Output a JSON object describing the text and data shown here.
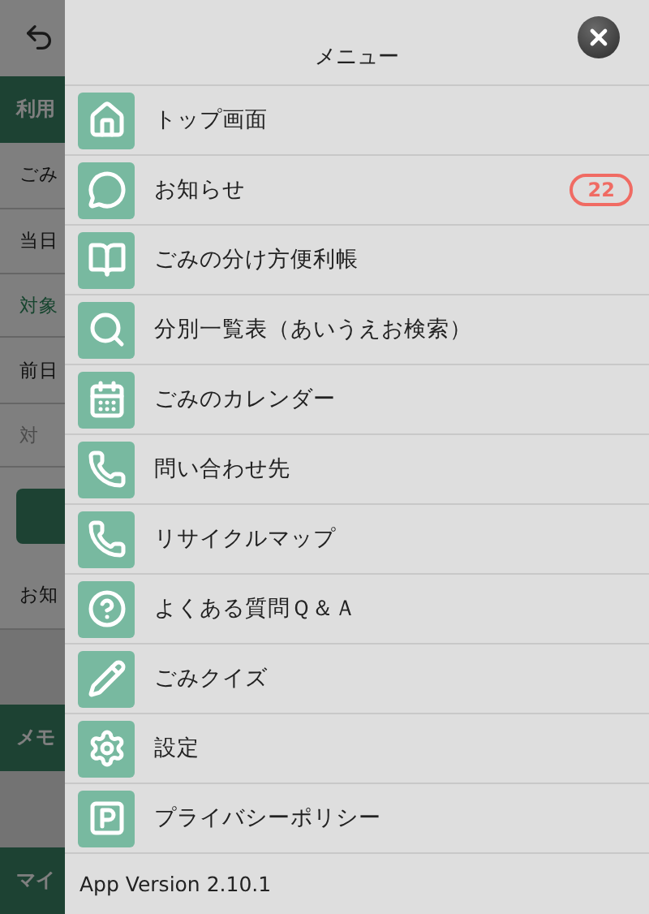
{
  "background": {
    "rows": [
      {
        "kind": "topbar"
      },
      {
        "kind": "band",
        "label": "利用"
      },
      {
        "kind": "row",
        "label": "ごみ"
      },
      {
        "kind": "row",
        "label": "当日"
      },
      {
        "kind": "link",
        "label": "対象"
      },
      {
        "kind": "row",
        "label": "前日"
      },
      {
        "kind": "muted",
        "label": "対"
      },
      {
        "kind": "button"
      },
      {
        "kind": "row",
        "label": "お知"
      },
      {
        "kind": "gap"
      },
      {
        "kind": "band",
        "label": "メモ"
      },
      {
        "kind": "gap"
      },
      {
        "kind": "band",
        "label": "マイ"
      }
    ]
  },
  "menu": {
    "title": "メニュー",
    "items": [
      {
        "label": "トップ画面"
      },
      {
        "label": "お知らせ",
        "badge": "22"
      },
      {
        "label": "ごみの分け方便利帳"
      },
      {
        "label": "分別一覧表（あいうえお検索）"
      },
      {
        "label": "ごみのカレンダー"
      },
      {
        "label": "問い合わせ先"
      },
      {
        "label": "リサイクルマップ"
      },
      {
        "label": "よくある質問Ｑ＆Ａ"
      },
      {
        "label": "ごみクイズ"
      },
      {
        "label": "設定"
      },
      {
        "label": "プライバシーポリシー"
      }
    ],
    "version": "App Version 2.10.1"
  }
}
